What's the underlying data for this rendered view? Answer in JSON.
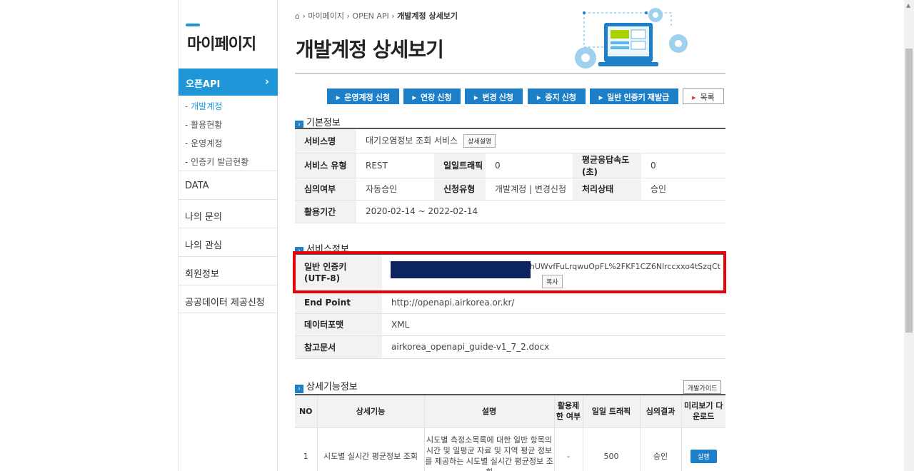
{
  "sidebar": {
    "title": "마이페이지",
    "active_section": "오픈API",
    "sub_items": [
      "- 개발계정",
      "- 활용현황",
      "- 운영계정",
      "- 인증키 발급현황"
    ],
    "menu_items": [
      "DATA",
      "나의 문의",
      "나의 관심",
      "회원정보",
      "공공데이터 제공신청"
    ]
  },
  "breadcrumb": {
    "items": [
      "마이페이지",
      "OPEN API"
    ],
    "current": "개발계정 상세보기"
  },
  "page_title": "개발계정 상세보기",
  "buttons": {
    "apply_operate": "운영계정 신청",
    "extend": "연장 신청",
    "change": "변경 신청",
    "stop": "중지 신청",
    "reissue_key": "일반 인증키 재발급",
    "list": "목록"
  },
  "basic_info": {
    "heading": "기본정보",
    "service_name_label": "서비스명",
    "service_name": "대기오염정보 조회 서비스",
    "detail_btn": "상세설명",
    "service_type_label": "서비스 유형",
    "service_type": "REST",
    "daily_traffic_label": "일일트래픽",
    "daily_traffic": "0",
    "avg_response_label": "평균응답속도(초)",
    "avg_response": "0",
    "review_label": "심의여부",
    "review": "자동승인",
    "request_type_label": "신청유형",
    "request_type": "개발계정 | 변경신청",
    "process_label": "처리상태",
    "process": "승인",
    "period_label": "활용기간",
    "period": "2020-02-14 ~ 2022-02-14"
  },
  "service_info": {
    "heading": "서비스정보",
    "key_label_1": "일반 인증키",
    "key_label_2": "(UTF-8)",
    "key_value_visible": "31ihUWvfFuLrqwuOpFL%2FKF1CZ6Nlrccxxo4tSzqCt",
    "copy_btn": "복사",
    "endpoint_label": "End Point",
    "endpoint": "http://openapi.airkorea.or.kr/",
    "format_label": "데이터포맷",
    "format": "XML",
    "doc_label": "참고문서",
    "doc": "airkorea_openapi_guide-v1_7_2.docx"
  },
  "detail_info": {
    "heading": "상세기능정보",
    "guide_btn": "개발가이드",
    "columns": [
      "NO",
      "상세기능",
      "설명",
      "활용제 한 여부",
      "일일 트래픽",
      "심의결과",
      "미리보기 다운로드"
    ],
    "rows": [
      {
        "no": "1",
        "feature": "시도별 실시간 평균정보 조회",
        "desc": "시도별 측정소목록에 대한 일반 항목의 시간 및 일평균 자료 및 지역 평균 정보를 제공하는 시도별 실시간 평균정보 조회",
        "limit": "-",
        "traffic": "500",
        "result": "승인",
        "action": "실행"
      }
    ]
  }
}
